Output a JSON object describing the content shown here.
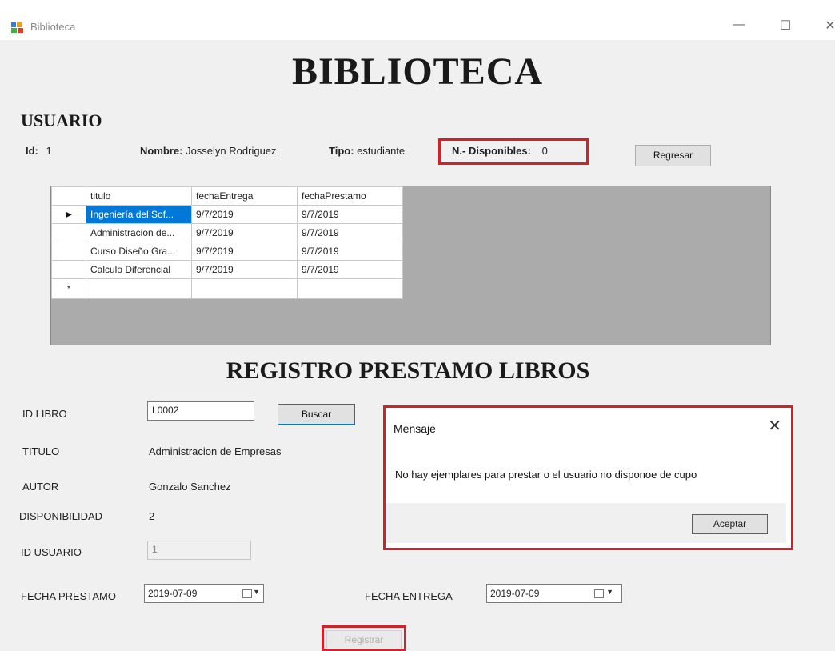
{
  "window": {
    "title": "Biblioteca",
    "minimize": "—",
    "maximize": "☐",
    "close": "✕"
  },
  "header": {
    "title": "BIBLIOTECA",
    "user_section": "USUARIO"
  },
  "user": {
    "id_label": "Id:",
    "id_value": "1",
    "name_label": "Nombre:",
    "name_value": "Josselyn Rodriguez",
    "type_label": "Tipo:",
    "type_value": "estudiante",
    "available_label": "N.- Disponibles:",
    "available_value": "0"
  },
  "buttons": {
    "back": "Regresar",
    "search": "Buscar",
    "register": "Registrar"
  },
  "grid": {
    "columns": [
      "titulo",
      "fechaEntrega",
      "fechaPrestamo"
    ],
    "rows": [
      [
        "Ingeniería del Sof...",
        "9/7/2019",
        "9/7/2019"
      ],
      [
        "Administracion de...",
        "9/7/2019",
        "9/7/2019"
      ],
      [
        "Curso Diseño Gra...",
        "9/7/2019",
        "9/7/2019"
      ],
      [
        "Calculo Diferencial",
        "9/7/2019",
        "9/7/2019"
      ]
    ],
    "current_row_marker": "▶",
    "new_row_marker": "*"
  },
  "register": {
    "title": "REGISTRO PRESTAMO LIBROS",
    "book_id_label": "ID LIBRO",
    "book_id_value": "L0002",
    "title_label": "TITULO",
    "title_value": "Administracion de Empresas",
    "author_label": "AUTOR",
    "author_value": "Gonzalo Sanchez",
    "availability_label": "DISPONIBILIDAD",
    "availability_value": "2",
    "user_id_label": "ID USUARIO",
    "user_id_value": "1",
    "loan_date_label": "FECHA PRESTAMO",
    "loan_date_value": "2019-07-09",
    "return_date_label": "FECHA ENTREGA",
    "return_date_value": "2019-07-09"
  },
  "dialog": {
    "title": "Mensaje",
    "close": "✕",
    "message": "No hay ejemplares para prestar o el usuario no disponoe de cupo",
    "ok": "Aceptar"
  },
  "colors": {
    "highlight": "#d32029",
    "selection": "#0078d7"
  }
}
